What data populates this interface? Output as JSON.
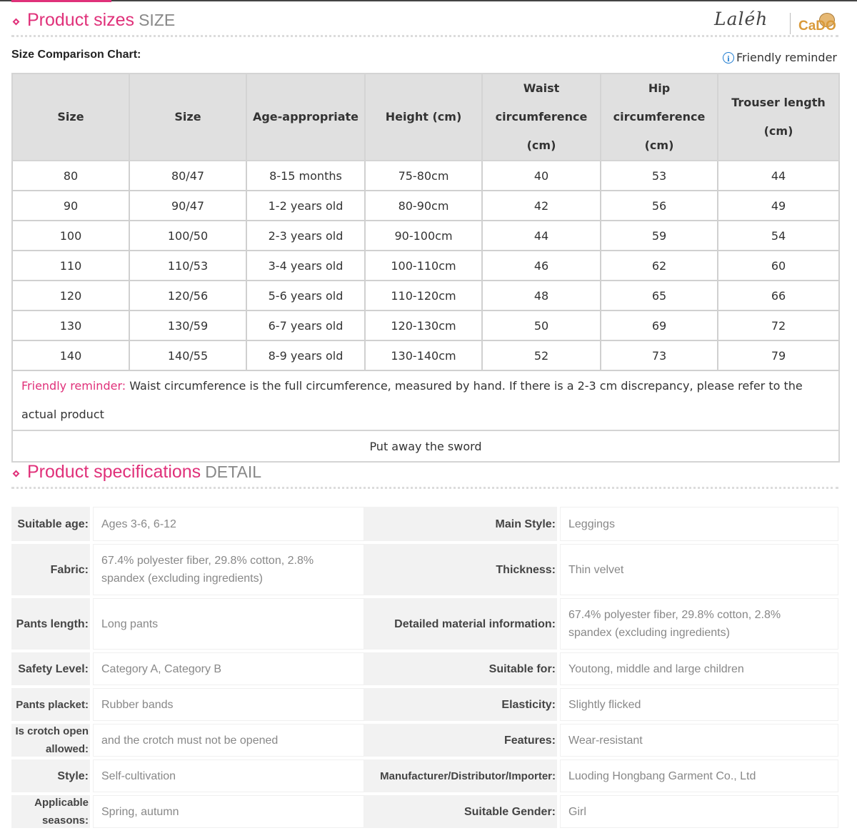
{
  "size_section": {
    "title": "Product sizes",
    "title_en": "SIZE"
  },
  "logo": {
    "script": "Laléh",
    "brand": "CaDO"
  },
  "chart_label": "Size Comparison Chart:",
  "reminder_link": "Friendly reminder",
  "size_table": {
    "headers": [
      "Size",
      "Size",
      "Age-appropriate",
      "Height (cm)",
      "Waist circumference (cm)",
      "Hip circumference (cm)",
      "Trouser length (cm)"
    ],
    "rows": [
      [
        "80",
        "80/47",
        "8-15 months",
        "75-80cm",
        "40",
        "53",
        "44"
      ],
      [
        "90",
        "90/47",
        "1-2 years old",
        "80-90cm",
        "42",
        "56",
        "49"
      ],
      [
        "100",
        "100/50",
        "2-3 years old",
        "90-100cm",
        "44",
        "59",
        "54"
      ],
      [
        "110",
        "110/53",
        "3-4 years old",
        "100-110cm",
        "46",
        "62",
        "60"
      ],
      [
        "120",
        "120/56",
        "5-6 years old",
        "110-120cm",
        "48",
        "65",
        "66"
      ],
      [
        "130",
        "130/59",
        "6-7 years old",
        "120-130cm",
        "50",
        "69",
        "72"
      ],
      [
        "140",
        "140/55",
        "8-9 years old",
        "130-140cm",
        "52",
        "73",
        "79"
      ]
    ],
    "note_label": "Friendly reminder:",
    "note_text": " Waist circumference is the full circumference, measured by hand. If there is a 2-3 cm discrepancy, please refer to the actual product",
    "footer": "Put away the sword"
  },
  "spec_section": {
    "title": "Product specifications",
    "title_en": "DETAIL"
  },
  "specs": [
    {
      "label_left": "Suitable age:",
      "value_left": "Ages 3-6, 6-12",
      "label_right": "Main Style:",
      "value_right": "Leggings"
    },
    {
      "label_left": "Fabric:",
      "value_left": "67.4% polyester fiber, 29.8% cotton, 2.8% spandex (excluding ingredients)",
      "label_right": "Thickness:",
      "value_right": "Thin velvet"
    },
    {
      "label_left": "Pants length:",
      "value_left": "Long pants",
      "label_right": "Detailed material information:",
      "value_right": "67.4% polyester fiber, 29.8% cotton, 2.8% spandex (excluding ingredients)"
    },
    {
      "label_left": "Safety Level:",
      "value_left": "Category A, Category B",
      "label_right": "Suitable for:",
      "value_right": "Youtong, middle and large children"
    },
    {
      "label_left": "Pants placket:",
      "value_left": "Rubber bands",
      "label_right": "Elasticity:",
      "value_right": "Slightly flicked"
    },
    {
      "label_left": "Is crotch open allowed:",
      "value_left": "and the crotch must not be opened",
      "label_right": "Features:",
      "value_right": "Wear-resistant"
    },
    {
      "label_left": "Style:",
      "value_left": "Self-cultivation",
      "label_right": "Manufacturer/Distributor/Importer:",
      "value_right": "Luoding Hongbang Garment Co., Ltd"
    },
    {
      "label_left": "Applicable seasons:",
      "value_left": "Spring, autumn",
      "label_right": "Suitable Gender:",
      "value_right": "Girl"
    }
  ]
}
